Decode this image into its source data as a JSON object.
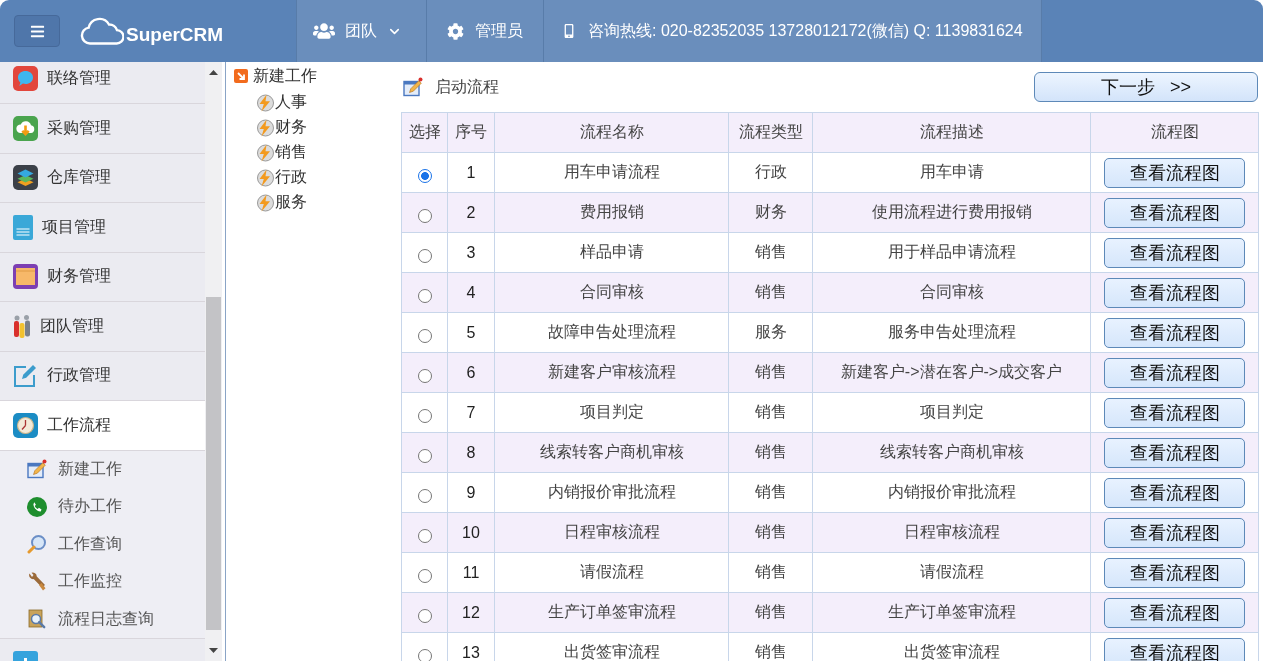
{
  "header": {
    "brand": "SuperCRM",
    "nav": [
      {
        "kind": "dropdown",
        "label": "团队"
      },
      {
        "kind": "link",
        "label": "管理员"
      },
      {
        "kind": "info",
        "label": "咨询热线: 020-82352035 13728012172(微信) Q: 1139831624"
      }
    ]
  },
  "sidebar": {
    "items": [
      {
        "label": "联络管理",
        "selected": false
      },
      {
        "label": "采购管理",
        "selected": false
      },
      {
        "label": "仓库管理",
        "selected": false
      },
      {
        "label": "项目管理",
        "selected": false
      },
      {
        "label": "财务管理",
        "selected": false
      },
      {
        "label": "团队管理",
        "selected": false
      },
      {
        "label": "行政管理",
        "selected": false
      },
      {
        "label": "工作流程",
        "selected": true,
        "children": [
          {
            "label": "新建工作"
          },
          {
            "label": "待办工作"
          },
          {
            "label": "工作查询"
          },
          {
            "label": "工作监控"
          },
          {
            "label": "流程日志查询"
          }
        ]
      },
      {
        "selected": false
      }
    ]
  },
  "tree": {
    "label": "新建工作",
    "children": [
      {
        "label": "人事"
      },
      {
        "label": "财务"
      },
      {
        "label": "销售"
      },
      {
        "label": "行政"
      },
      {
        "label": "服务"
      }
    ]
  },
  "main": {
    "title": "启动流程",
    "next_button": "下一步 >>",
    "table": {
      "columns": [
        "选择",
        "序号",
        "流程名称",
        "流程类型",
        "流程描述",
        "流程图"
      ],
      "rows": [
        {
          "selected": true,
          "number": "1",
          "name": "用车申请流程",
          "type": "行政",
          "description": "用车申请",
          "action": "查看流程图"
        },
        {
          "selected": false,
          "number": "2",
          "name": "费用报销",
          "type": "财务",
          "description": "使用流程进行费用报销",
          "action": "查看流程图"
        },
        {
          "selected": false,
          "number": "3",
          "name": "样品申请",
          "type": "销售",
          "description": "用于样品申请流程",
          "action": "查看流程图"
        },
        {
          "selected": false,
          "number": "4",
          "name": "合同审核",
          "type": "销售",
          "description": "合同审核",
          "action": "查看流程图"
        },
        {
          "selected": false,
          "number": "5",
          "name": "故障申告处理流程",
          "type": "服务",
          "description": "服务申告处理流程",
          "action": "查看流程图"
        },
        {
          "selected": false,
          "number": "6",
          "name": "新建客户审核流程",
          "type": "销售",
          "description": "新建客户->潜在客户->成交客户",
          "action": "查看流程图"
        },
        {
          "selected": false,
          "number": "7",
          "name": "项目判定",
          "type": "销售",
          "description": "项目判定",
          "action": "查看流程图"
        },
        {
          "selected": false,
          "number": "8",
          "name": "线索转客户商机审核",
          "type": "销售",
          "description": "线索转客户商机审核",
          "action": "查看流程图"
        },
        {
          "selected": false,
          "number": "9",
          "name": "内销报价审批流程",
          "type": "销售",
          "description": "内销报价审批流程",
          "action": "查看流程图"
        },
        {
          "selected": false,
          "number": "10",
          "name": "日程审核流程",
          "type": "销售",
          "description": "日程审核流程",
          "action": "查看流程图"
        },
        {
          "selected": false,
          "number": "11",
          "name": "请假流程",
          "type": "销售",
          "description": "请假流程",
          "action": "查看流程图"
        },
        {
          "selected": false,
          "number": "12",
          "name": "生产订单签审流程",
          "type": "销售",
          "description": "生产订单签审流程",
          "action": "查看流程图"
        },
        {
          "selected": false,
          "number": "13",
          "name": "出货签审流程",
          "type": "销售",
          "description": "出货签审流程",
          "action": "查看流程图"
        }
      ]
    }
  }
}
